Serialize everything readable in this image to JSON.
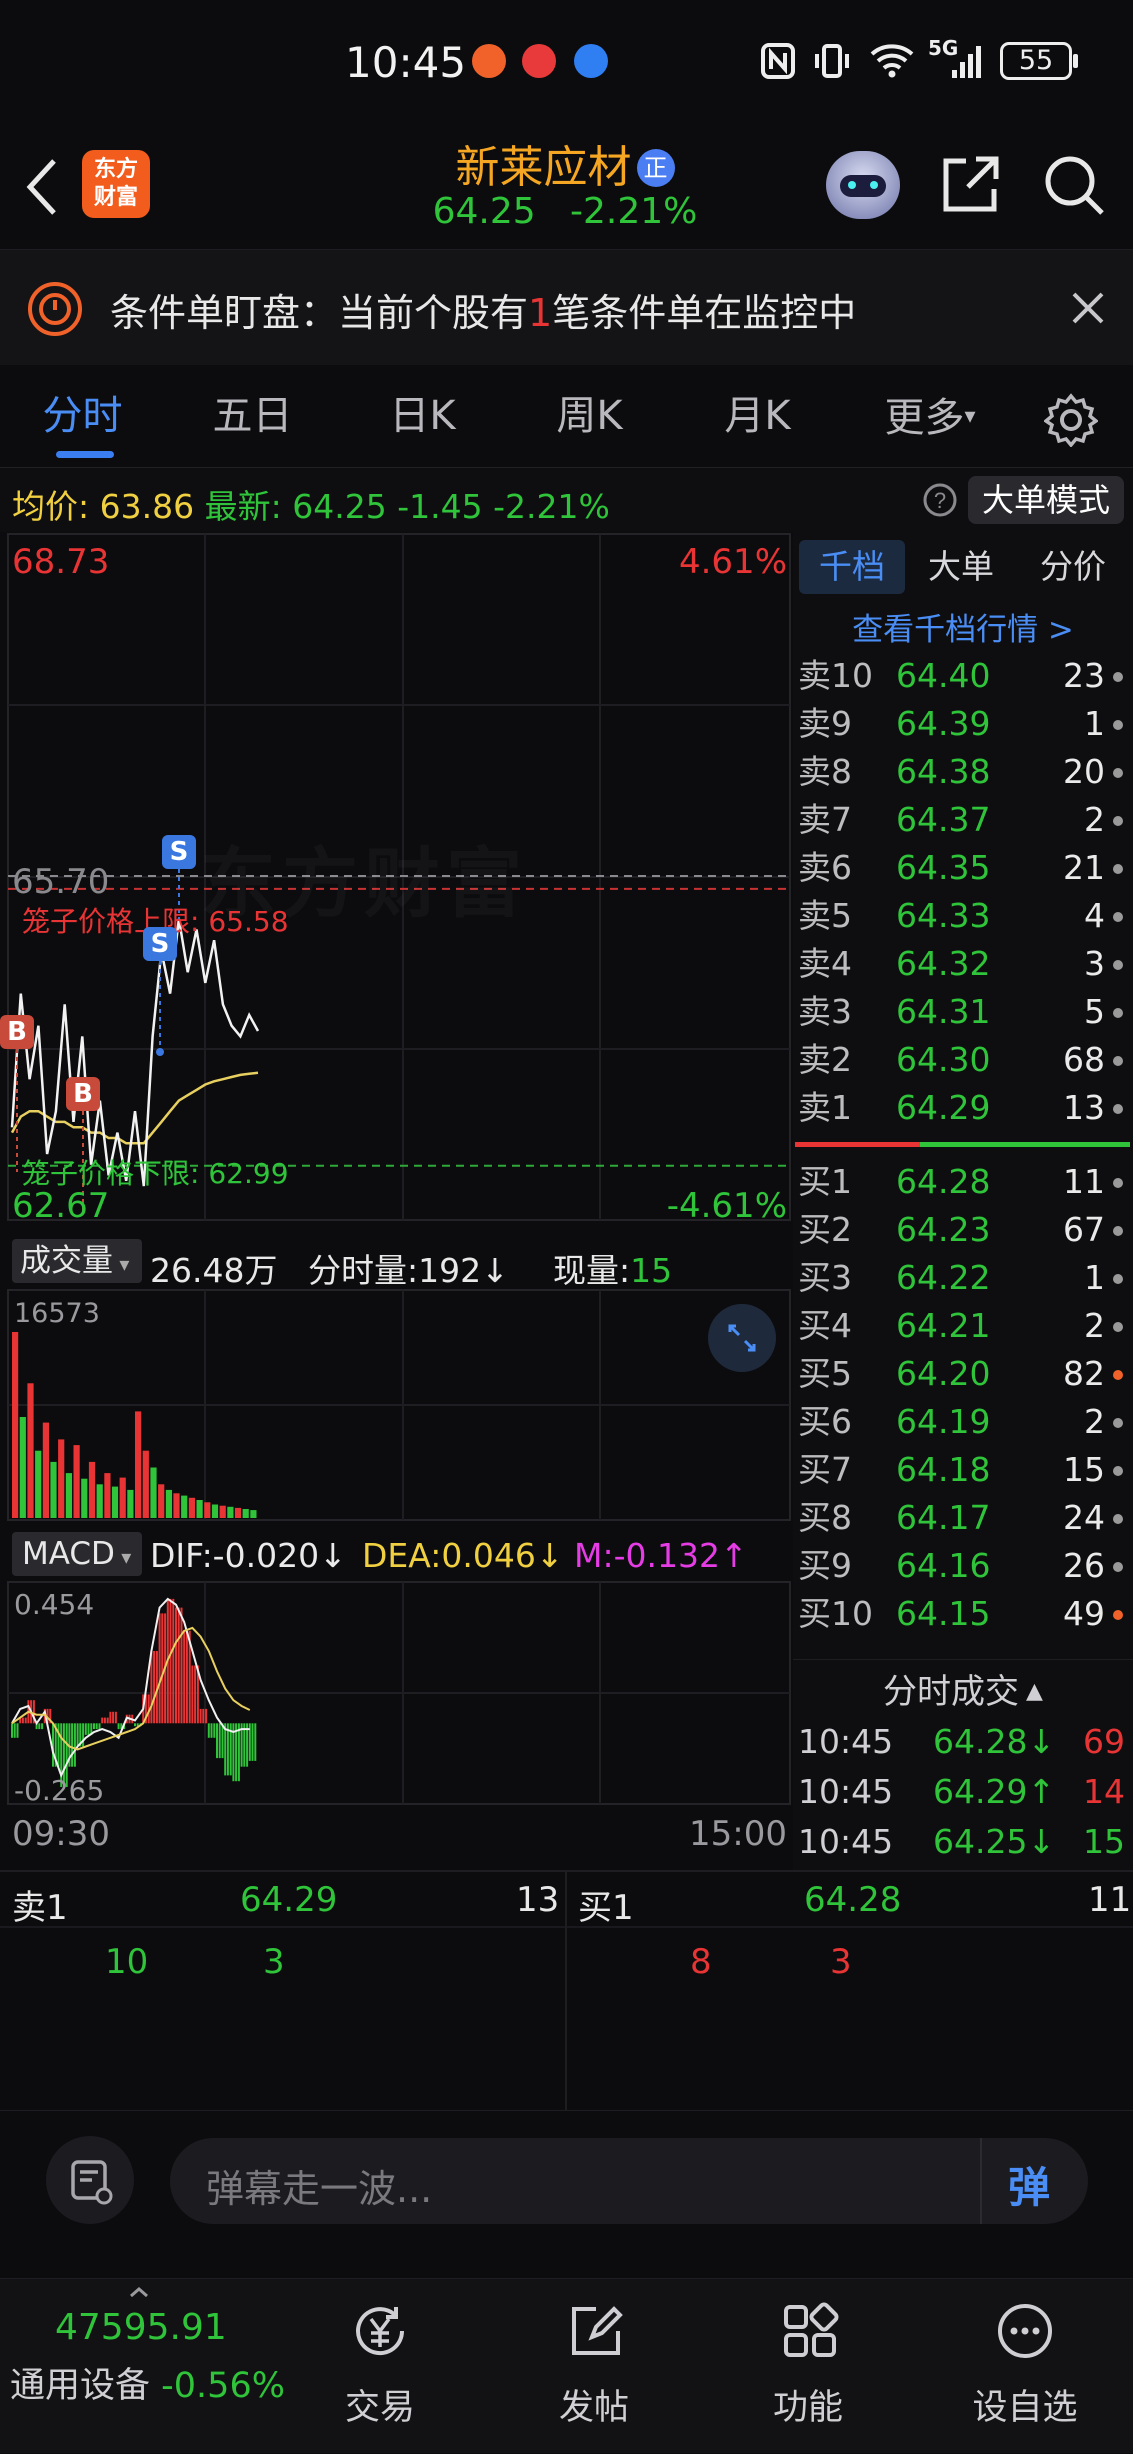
{
  "status": {
    "time": "10:45",
    "battery": "55",
    "network": "5G"
  },
  "nav": {
    "back_icon": "chevron-left-icon",
    "logo_text_1": "东方",
    "logo_text_2": "财富",
    "stock_name": "新莱应材",
    "badge": "正",
    "price": "64.25",
    "change_pct": "-2.21%",
    "robot_icon": "robot-icon",
    "share_icon": "share-icon",
    "search_icon": "search-icon"
  },
  "condition_bar": {
    "text_prefix": "条件单盯盘：当前个股有",
    "count": "1",
    "text_suffix": "笔条件单在监控中"
  },
  "tabs": [
    "分时",
    "五日",
    "日K",
    "周K",
    "月K",
    "更多"
  ],
  "avg_row": {
    "avg_label": "均价:",
    "avg_value": "63.86",
    "latest_label": "最新:",
    "latest_value": "64.25",
    "change": "-1.45",
    "change_pct": "-2.21%",
    "mode_button": "大单模式"
  },
  "chart": {
    "high_price": "68.73",
    "high_pct": "4.61%",
    "low_price": "62.67",
    "low_pct": "-4.61%",
    "ref_price": "65.70",
    "upper_limit_label": "笼子价格上限:",
    "upper_limit_value": "65.58",
    "lower_limit_label": "笼子价格下限:",
    "lower_limit_value": "62.99",
    "watermark": "东方财富",
    "vol_selector": "成交量",
    "vol_total": "26.48万",
    "tick_label": "分时量:",
    "tick_value": "192↓",
    "now_label": "现量:",
    "now_value": "15",
    "vol_max": "16573",
    "macd_selector": "MACD",
    "dif_label": "DIF:-0.020↓",
    "dea_label": "DEA:0.046↓",
    "m_label": "M:-0.132↑",
    "macd_max": "0.454",
    "macd_min": "-0.265",
    "time_start": "09:30",
    "time_end": "15:00",
    "price_series": [
      63.35,
      64.6,
      63.8,
      64.3,
      63.1,
      63.5,
      64.5,
      63.4,
      64.2,
      63.0,
      63.6,
      62.9,
      63.3,
      62.85,
      63.5,
      62.8,
      64.2,
      65.0,
      64.6,
      65.3,
      64.8,
      65.2,
      64.7,
      65.1,
      64.5,
      64.3,
      64.2,
      64.4,
      64.25
    ],
    "avg_series": [
      63.3,
      63.45,
      63.5,
      63.5,
      63.45,
      63.4,
      63.4,
      63.35,
      63.35,
      63.3,
      63.3,
      63.25,
      63.25,
      63.2,
      63.2,
      63.2,
      63.3,
      63.4,
      63.5,
      63.6,
      63.65,
      63.7,
      63.75,
      63.78,
      63.8,
      63.82,
      63.84,
      63.85,
      63.86
    ],
    "volumes": [
      16573,
      9000,
      12000,
      6000,
      8500,
      5000,
      7000,
      4000,
      6500,
      3500,
      5000,
      3000,
      4000,
      2800,
      3600,
      2500,
      9500,
      6000,
      4500,
      3000,
      2500,
      2200,
      2000,
      1800,
      1600,
      1400,
      1200,
      1100,
      1000,
      900,
      800,
      700
    ],
    "volume_colors": [
      "red",
      "green",
      "red",
      "green",
      "red",
      "green",
      "red",
      "green",
      "red",
      "green",
      "red",
      "green",
      "red",
      "green",
      "red",
      "green",
      "red",
      "red",
      "green",
      "red",
      "green",
      "red",
      "green",
      "red",
      "green",
      "red",
      "green",
      "red",
      "green",
      "red",
      "green",
      "green"
    ],
    "macd_bars": [
      -0.05,
      0.02,
      0.08,
      -0.02,
      0.05,
      -0.15,
      -0.22,
      -0.15,
      -0.08,
      -0.04,
      -0.02,
      0.02,
      0.04,
      -0.02,
      0.03,
      -0.01,
      0.1,
      0.25,
      0.38,
      0.43,
      0.4,
      0.32,
      0.2,
      0.05,
      -0.05,
      -0.12,
      -0.18,
      -0.2,
      -0.15,
      -0.13
    ]
  },
  "right_tabs": [
    "千档",
    "大单",
    "分价"
  ],
  "view_more": "查看千档行情 >",
  "asks": [
    {
      "label": "卖10",
      "price": "64.40",
      "vol": "23"
    },
    {
      "label": "卖9",
      "price": "64.39",
      "vol": "1"
    },
    {
      "label": "卖8",
      "price": "64.38",
      "vol": "20"
    },
    {
      "label": "卖7",
      "price": "64.37",
      "vol": "2"
    },
    {
      "label": "卖6",
      "price": "64.35",
      "vol": "21"
    },
    {
      "label": "卖5",
      "price": "64.33",
      "vol": "4"
    },
    {
      "label": "卖4",
      "price": "64.32",
      "vol": "3"
    },
    {
      "label": "卖3",
      "price": "64.31",
      "vol": "5"
    },
    {
      "label": "卖2",
      "price": "64.30",
      "vol": "68"
    },
    {
      "label": "卖1",
      "price": "64.29",
      "vol": "13"
    }
  ],
  "bids": [
    {
      "label": "买1",
      "price": "64.28",
      "vol": "11"
    },
    {
      "label": "买2",
      "price": "64.23",
      "vol": "67"
    },
    {
      "label": "买3",
      "price": "64.22",
      "vol": "1"
    },
    {
      "label": "买4",
      "price": "64.21",
      "vol": "2"
    },
    {
      "label": "买5",
      "price": "64.20",
      "vol": "82"
    },
    {
      "label": "买6",
      "price": "64.19",
      "vol": "2"
    },
    {
      "label": "买7",
      "price": "64.18",
      "vol": "15"
    },
    {
      "label": "买8",
      "price": "64.17",
      "vol": "24"
    },
    {
      "label": "买9",
      "price": "64.16",
      "vol": "26"
    },
    {
      "label": "买10",
      "price": "64.15",
      "vol": "49"
    }
  ],
  "trades_header": "分时成交",
  "trades": [
    {
      "time": "10:45",
      "price": "64.28↓",
      "vol": "69"
    },
    {
      "time": "10:45",
      "price": "64.29↑",
      "vol": "14"
    },
    {
      "time": "10:45",
      "price": "64.25↓",
      "vol": "15"
    }
  ],
  "book_bottom": {
    "sell_label": "卖1",
    "sell_price": "64.29",
    "sell_vol": "13",
    "sell_q1": "10",
    "sell_q2": "3",
    "buy_label": "买1",
    "buy_price": "64.28",
    "buy_vol": "11",
    "buy_q1": "8",
    "buy_q2": "3"
  },
  "danmu": {
    "placeholder": "弹幕走一波...",
    "button": "弹"
  },
  "bottom_nav": {
    "index_value": "47595.91",
    "index_name": "通用设备",
    "index_change": "-0.56%",
    "items": [
      "交易",
      "发帖",
      "功能",
      "设自选"
    ]
  }
}
